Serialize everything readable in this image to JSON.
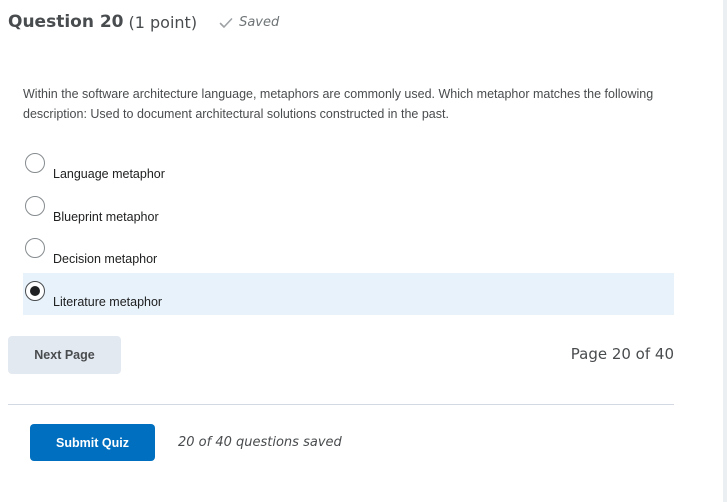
{
  "question": {
    "title": "Question 20",
    "points": "(1 point)",
    "status_icon": "check-icon",
    "status": "Saved",
    "text": "Within the software architecture language, metaphors are commonly used. Which metaphor matches the following description: Used to document architectural solutions constructed in the past."
  },
  "options": [
    {
      "label": "Language metaphor",
      "selected": false
    },
    {
      "label": "Blueprint metaphor",
      "selected": false
    },
    {
      "label": "Decision metaphor",
      "selected": false
    },
    {
      "label": "Literature metaphor",
      "selected": true
    }
  ],
  "navigation": {
    "next_label": "Next Page",
    "page_indicator": "Page 20 of 40"
  },
  "footer": {
    "submit_label": "Submit Quiz",
    "saved_count": "20 of 40 questions saved"
  },
  "colors": {
    "primary": "#006fbf",
    "selected_bg": "#e8f2fb",
    "secondary_button": "#e3e9f1",
    "text": "#494c4e"
  }
}
